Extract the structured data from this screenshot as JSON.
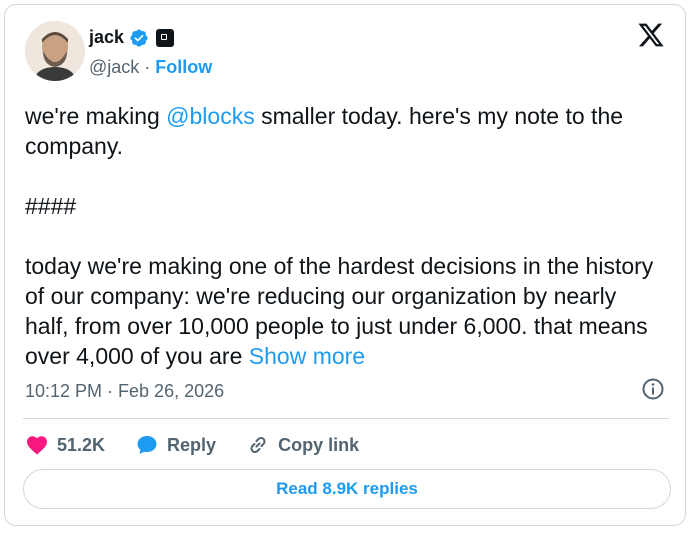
{
  "author": {
    "name": "jack",
    "handle": "@jack",
    "follow_label": "Follow",
    "separator": " · "
  },
  "tweet": {
    "line1_pre": "we're making ",
    "mention": "@blocks",
    "line1_post": " smaller today. here's my note to the company.",
    "line2": "####",
    "line3": "today we're making one of the hardest decisions in the history of our company: we're reducing our organization by nearly half, from over 10,000 people to just under 6,000. that means over 4,000 of you are ",
    "show_more": "Show more"
  },
  "meta": {
    "timestamp": "10:12 PM · Feb 26, 2026"
  },
  "actions": {
    "likes": "51.2K",
    "reply_label": "Reply",
    "copy_link_label": "Copy link"
  },
  "footer": {
    "read_replies": "Read 8.9K replies"
  },
  "colors": {
    "accent": "#1d9bf0",
    "like": "#f91880",
    "text": "#0f1419",
    "muted": "#536471",
    "border": "#cfd9de"
  },
  "icons": [
    "verified-badge-icon",
    "affiliate-square-icon",
    "x-logo-icon",
    "info-icon",
    "heart-icon",
    "reply-bubble-icon",
    "link-icon"
  ]
}
